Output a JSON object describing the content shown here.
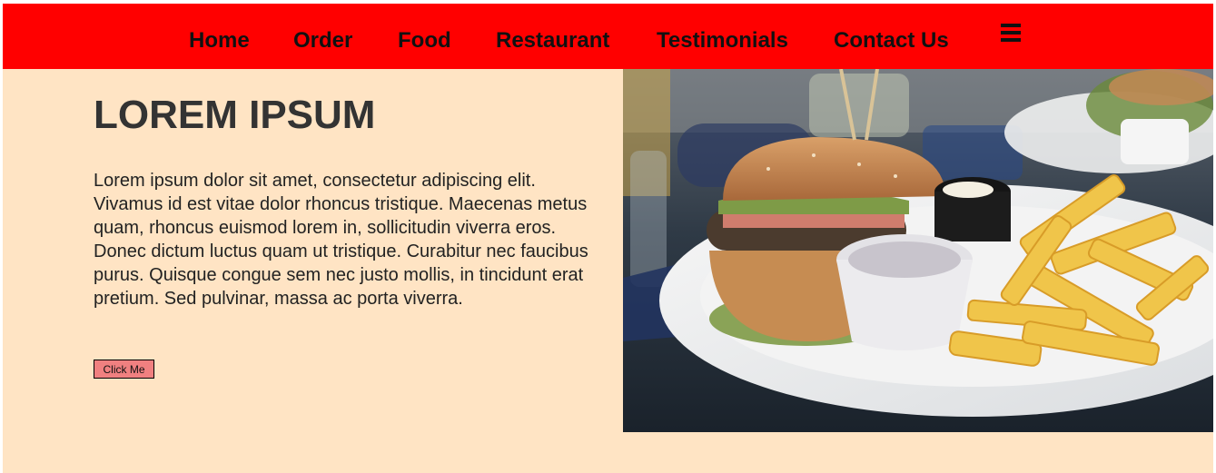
{
  "nav": {
    "items": [
      "Home",
      "Order",
      "Food",
      "Restaurant",
      "Testimonials",
      "Contact Us"
    ],
    "menu_icon": "hamburger-menu-icon"
  },
  "hero": {
    "title": "LOREM IPSUM",
    "body": "Lorem ipsum dolor sit amet, consectetur adipiscing elit. Vivamus id est vitae dolor rhoncus tristique. Maecenas metus quam, rhoncus euismod lorem in, sollicitudin viverra eros. Donec dictum luctus quam ut tristique. Curabitur nec faucibus purus. Quisque congue sem nec justo mollis, in tincidunt erat pretium. Sed pulvinar, massa ac porta viverra.",
    "button_label": "Click Me",
    "image_icon": "burger-and-fries-photo"
  },
  "colors": {
    "nav_background": "#ff0000",
    "page_background": "#ffe4c4",
    "button_background": "#f08080"
  }
}
